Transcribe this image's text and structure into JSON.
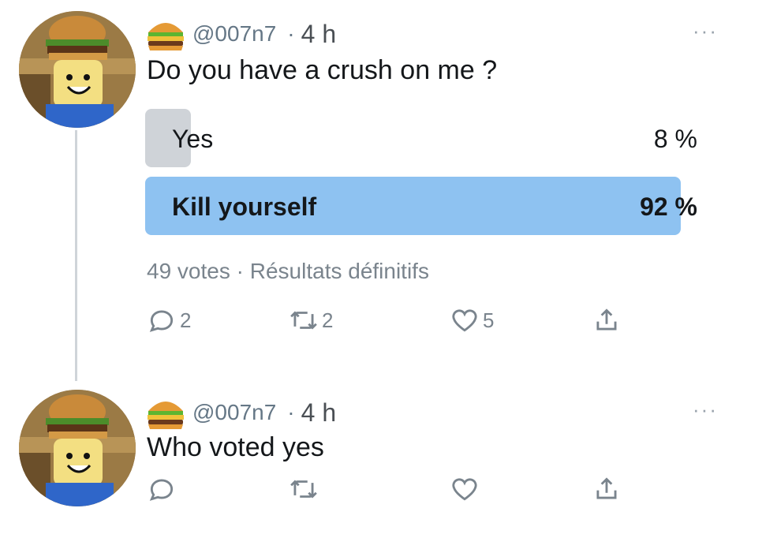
{
  "tweets": [
    {
      "handle": "@007n7",
      "separator": "·",
      "time": "4 h",
      "more": "···",
      "text": "Do you have a crush on me ?",
      "poll": {
        "options": [
          {
            "label": "Yes",
            "percent": "8 %",
            "fill_fraction": 0.08
          },
          {
            "label": "Kill yourself",
            "percent": "92 %",
            "fill_fraction": 0.965
          }
        ],
        "votes": "49 votes",
        "separator": "·",
        "status": "Résultats définitifs"
      },
      "actions": {
        "reply_count": "2",
        "retweet_count": "2",
        "like_count": "5"
      }
    },
    {
      "handle": "@007n7",
      "separator": "·",
      "time": "4 h",
      "more": "···",
      "text": "Who voted yes",
      "actions": {
        "reply_count": "",
        "retweet_count": "",
        "like_count": ""
      }
    }
  ],
  "icons": {
    "emoji": "hamburger-emoji",
    "reply": "reply-icon",
    "retweet": "retweet-icon",
    "like": "heart-icon",
    "share": "share-icon",
    "more": "more-icon"
  },
  "colors": {
    "poll_winner": "#8ec2f1",
    "poll_other": "#cfd3d8",
    "muted_text": "#7a848d",
    "thread_line": "#cfd4d9"
  }
}
